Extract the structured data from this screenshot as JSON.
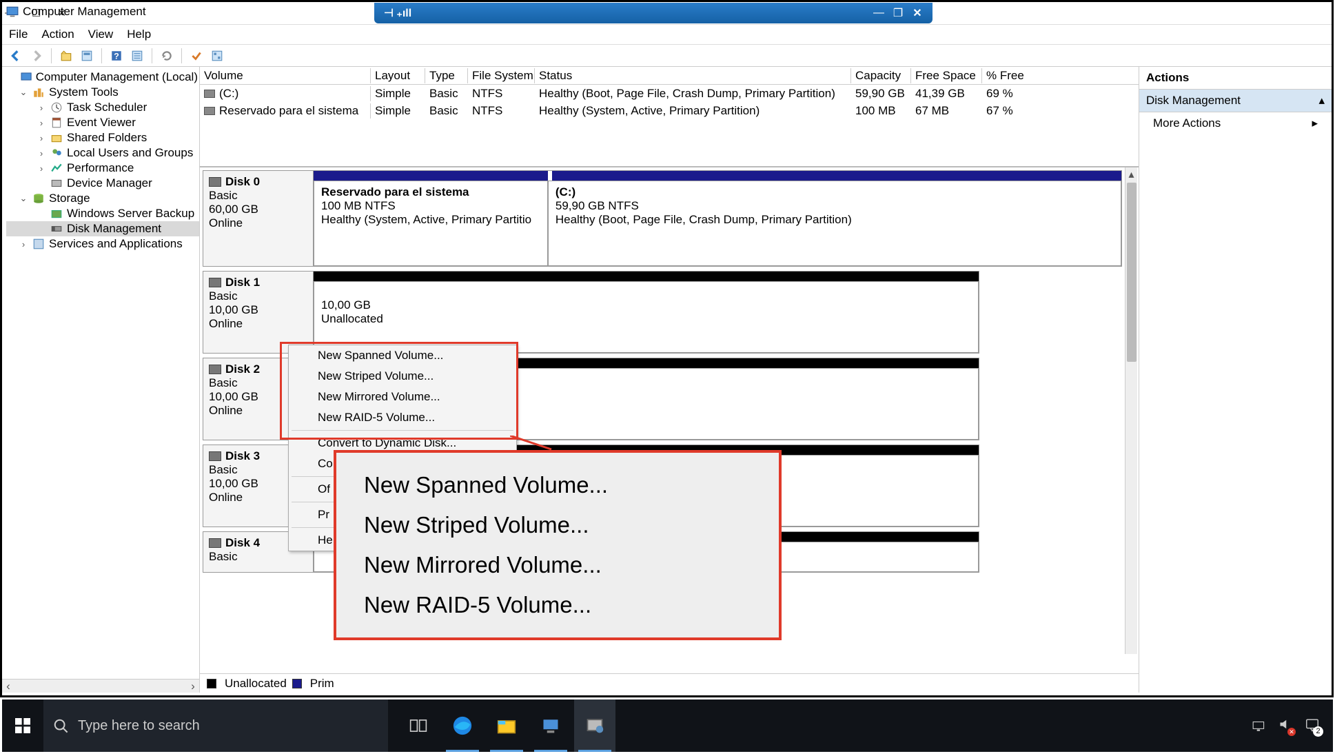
{
  "window": {
    "title": "Computer Management"
  },
  "menus": {
    "file": "File",
    "action": "Action",
    "view": "View",
    "help": "Help"
  },
  "tree": {
    "root": "Computer Management (Local)",
    "system_tools": "System Tools",
    "task_sched": "Task Scheduler",
    "event_viewer": "Event Viewer",
    "shared": "Shared Folders",
    "users": "Local Users and Groups",
    "perf": "Performance",
    "devmgr": "Device Manager",
    "storage": "Storage",
    "wsb": "Windows Server Backup",
    "diskmgmt": "Disk Management",
    "services": "Services and Applications"
  },
  "cols": {
    "volume": "Volume",
    "layout": "Layout",
    "type": "Type",
    "fs": "File System",
    "status": "Status",
    "cap": "Capacity",
    "free": "Free Space",
    "pct": "% Free"
  },
  "volumes": [
    {
      "name": "(C:)",
      "layout": "Simple",
      "type": "Basic",
      "fs": "NTFS",
      "status": "Healthy (Boot, Page File, Crash Dump, Primary Partition)",
      "cap": "59,90 GB",
      "free": "41,39 GB",
      "pct": "69 %"
    },
    {
      "name": "Reservado para el sistema",
      "layout": "Simple",
      "type": "Basic",
      "fs": "NTFS",
      "status": "Healthy (System, Active, Primary Partition)",
      "cap": "100 MB",
      "free": "67 MB",
      "pct": "67 %"
    }
  ],
  "disks": {
    "d0": {
      "name": "Disk 0",
      "type": "Basic",
      "size": "60,00 GB",
      "state": "Online",
      "p0": {
        "name": "Reservado para el sistema",
        "size": "100 MB NTFS",
        "status": "Healthy (System, Active, Primary Partitio"
      },
      "p1": {
        "name": "(C:)",
        "size": "59,90 GB NTFS",
        "status": "Healthy (Boot, Page File, Crash Dump, Primary Partition)"
      }
    },
    "d1": {
      "name": "Disk 1",
      "type": "Basic",
      "size": "10,00 GB",
      "state": "Online",
      "p0": {
        "size": "10,00 GB",
        "status": "Unallocated"
      }
    },
    "d2": {
      "name": "Disk 2",
      "type": "Basic",
      "size": "10,00 GB",
      "state": "Online"
    },
    "d3": {
      "name": "Disk 3",
      "type": "Basic",
      "size": "10,00 GB",
      "state": "Online"
    },
    "d4": {
      "name": "Disk 4",
      "type": "Basic"
    }
  },
  "ctx": {
    "spanned": "New Spanned Volume...",
    "striped": "New Striped Volume...",
    "mirrored": "New Mirrored Volume...",
    "raid5": "New RAID-5 Volume...",
    "convert": "Convert to Dynamic Disk...",
    "cc": "Co",
    "off": "Of",
    "pr": "Pr",
    "he": "He"
  },
  "zoom": {
    "spanned": "New Spanned Volume...",
    "striped": "New Striped Volume...",
    "mirrored": "New Mirrored Volume...",
    "raid5": "New RAID-5 Volume..."
  },
  "legend": {
    "unalloc": "Unallocated",
    "prim": "Prim"
  },
  "actions": {
    "header": "Actions",
    "diskmgmt": "Disk Management",
    "more": "More Actions"
  },
  "taskbar": {
    "search": "Type here to search",
    "notif": "2"
  }
}
